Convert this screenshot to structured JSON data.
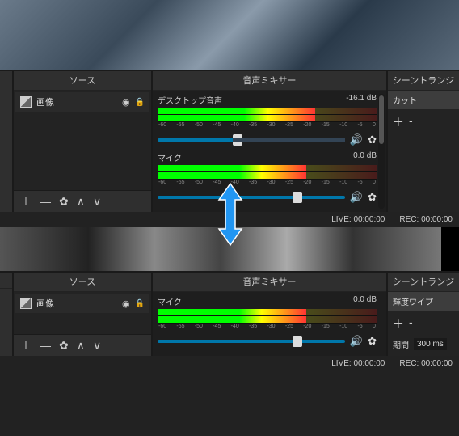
{
  "panels": {
    "sources_title": "ソース",
    "mixer_title": "音声ミキサー",
    "trans_title": "シーントランジ"
  },
  "sources": {
    "item_label": "画像"
  },
  "mixer": {
    "desktop": {
      "name": "デスクトップ音声",
      "db": "-16.1 dB"
    },
    "mic": {
      "name": "マイク",
      "db": "0.0 dB"
    },
    "ticks": [
      "-60",
      "-55",
      "-50",
      "-45",
      "-40",
      "-35",
      "-30",
      "-25",
      "-20",
      "-15",
      "-10",
      "-5",
      "0"
    ]
  },
  "trans": {
    "cut": "カット",
    "wipe": "輝度ワイプ",
    "dur_label": "期間",
    "dur_val": "300 ms"
  },
  "status": {
    "live_label": "LIVE:",
    "live_time": "00:00:00",
    "rec_label": "REC:",
    "rec_time": "00:00:00"
  }
}
